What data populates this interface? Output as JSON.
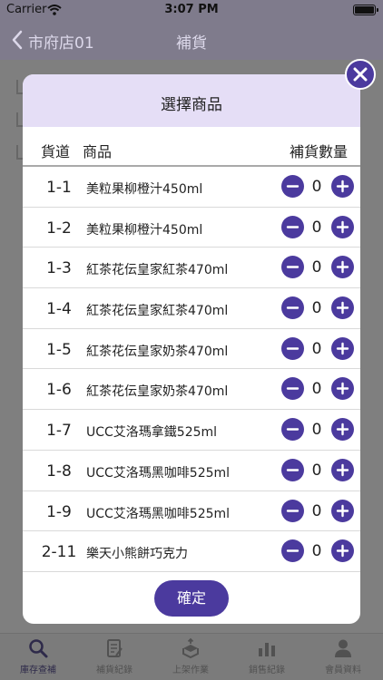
{
  "status_bar": {
    "carrier": "Carrier",
    "time": "3:07 PM"
  },
  "nav": {
    "back_label": "市府店01",
    "title": "補貨"
  },
  "modal": {
    "title": "選擇商品",
    "columns": {
      "code": "貨道",
      "name": "商品",
      "qty": "補貨數量"
    },
    "rows": [
      {
        "code": "1-1",
        "name": "美粒果柳橙汁450ml",
        "qty": "0"
      },
      {
        "code": "1-2",
        "name": "美粒果柳橙汁450ml",
        "qty": "0"
      },
      {
        "code": "1-3",
        "name": "紅茶花伝皇家紅茶470ml",
        "qty": "0"
      },
      {
        "code": "1-4",
        "name": "紅茶花伝皇家紅茶470ml",
        "qty": "0"
      },
      {
        "code": "1-5",
        "name": "紅茶花伝皇家奶茶470ml",
        "qty": "0"
      },
      {
        "code": "1-6",
        "name": "紅茶花伝皇家奶茶470ml",
        "qty": "0"
      },
      {
        "code": "1-7",
        "name": "UCC艾洛瑪拿鐵525ml",
        "qty": "0"
      },
      {
        "code": "1-8",
        "name": "UCC艾洛瑪黑咖啡525ml",
        "qty": "0"
      },
      {
        "code": "1-9",
        "name": "UCC艾洛瑪黑咖啡525ml",
        "qty": "0"
      },
      {
        "code": "2-11",
        "name": "樂天小熊餅巧克力",
        "qty": "0"
      }
    ],
    "confirm_label": "確定"
  },
  "tabs": [
    {
      "label": "庫存查補",
      "icon": "search-icon",
      "active": true
    },
    {
      "label": "補貨紀錄",
      "icon": "document-icon",
      "active": false
    },
    {
      "label": "上架作業",
      "icon": "box-icon",
      "active": false
    },
    {
      "label": "銷售紀錄",
      "icon": "bar-chart-icon",
      "active": false
    },
    {
      "label": "會員資料",
      "icon": "user-icon",
      "active": false
    }
  ],
  "colors": {
    "accent": "#4b3a9e",
    "modal_header": "#e5def6",
    "overlay": "#7f7f7f"
  }
}
